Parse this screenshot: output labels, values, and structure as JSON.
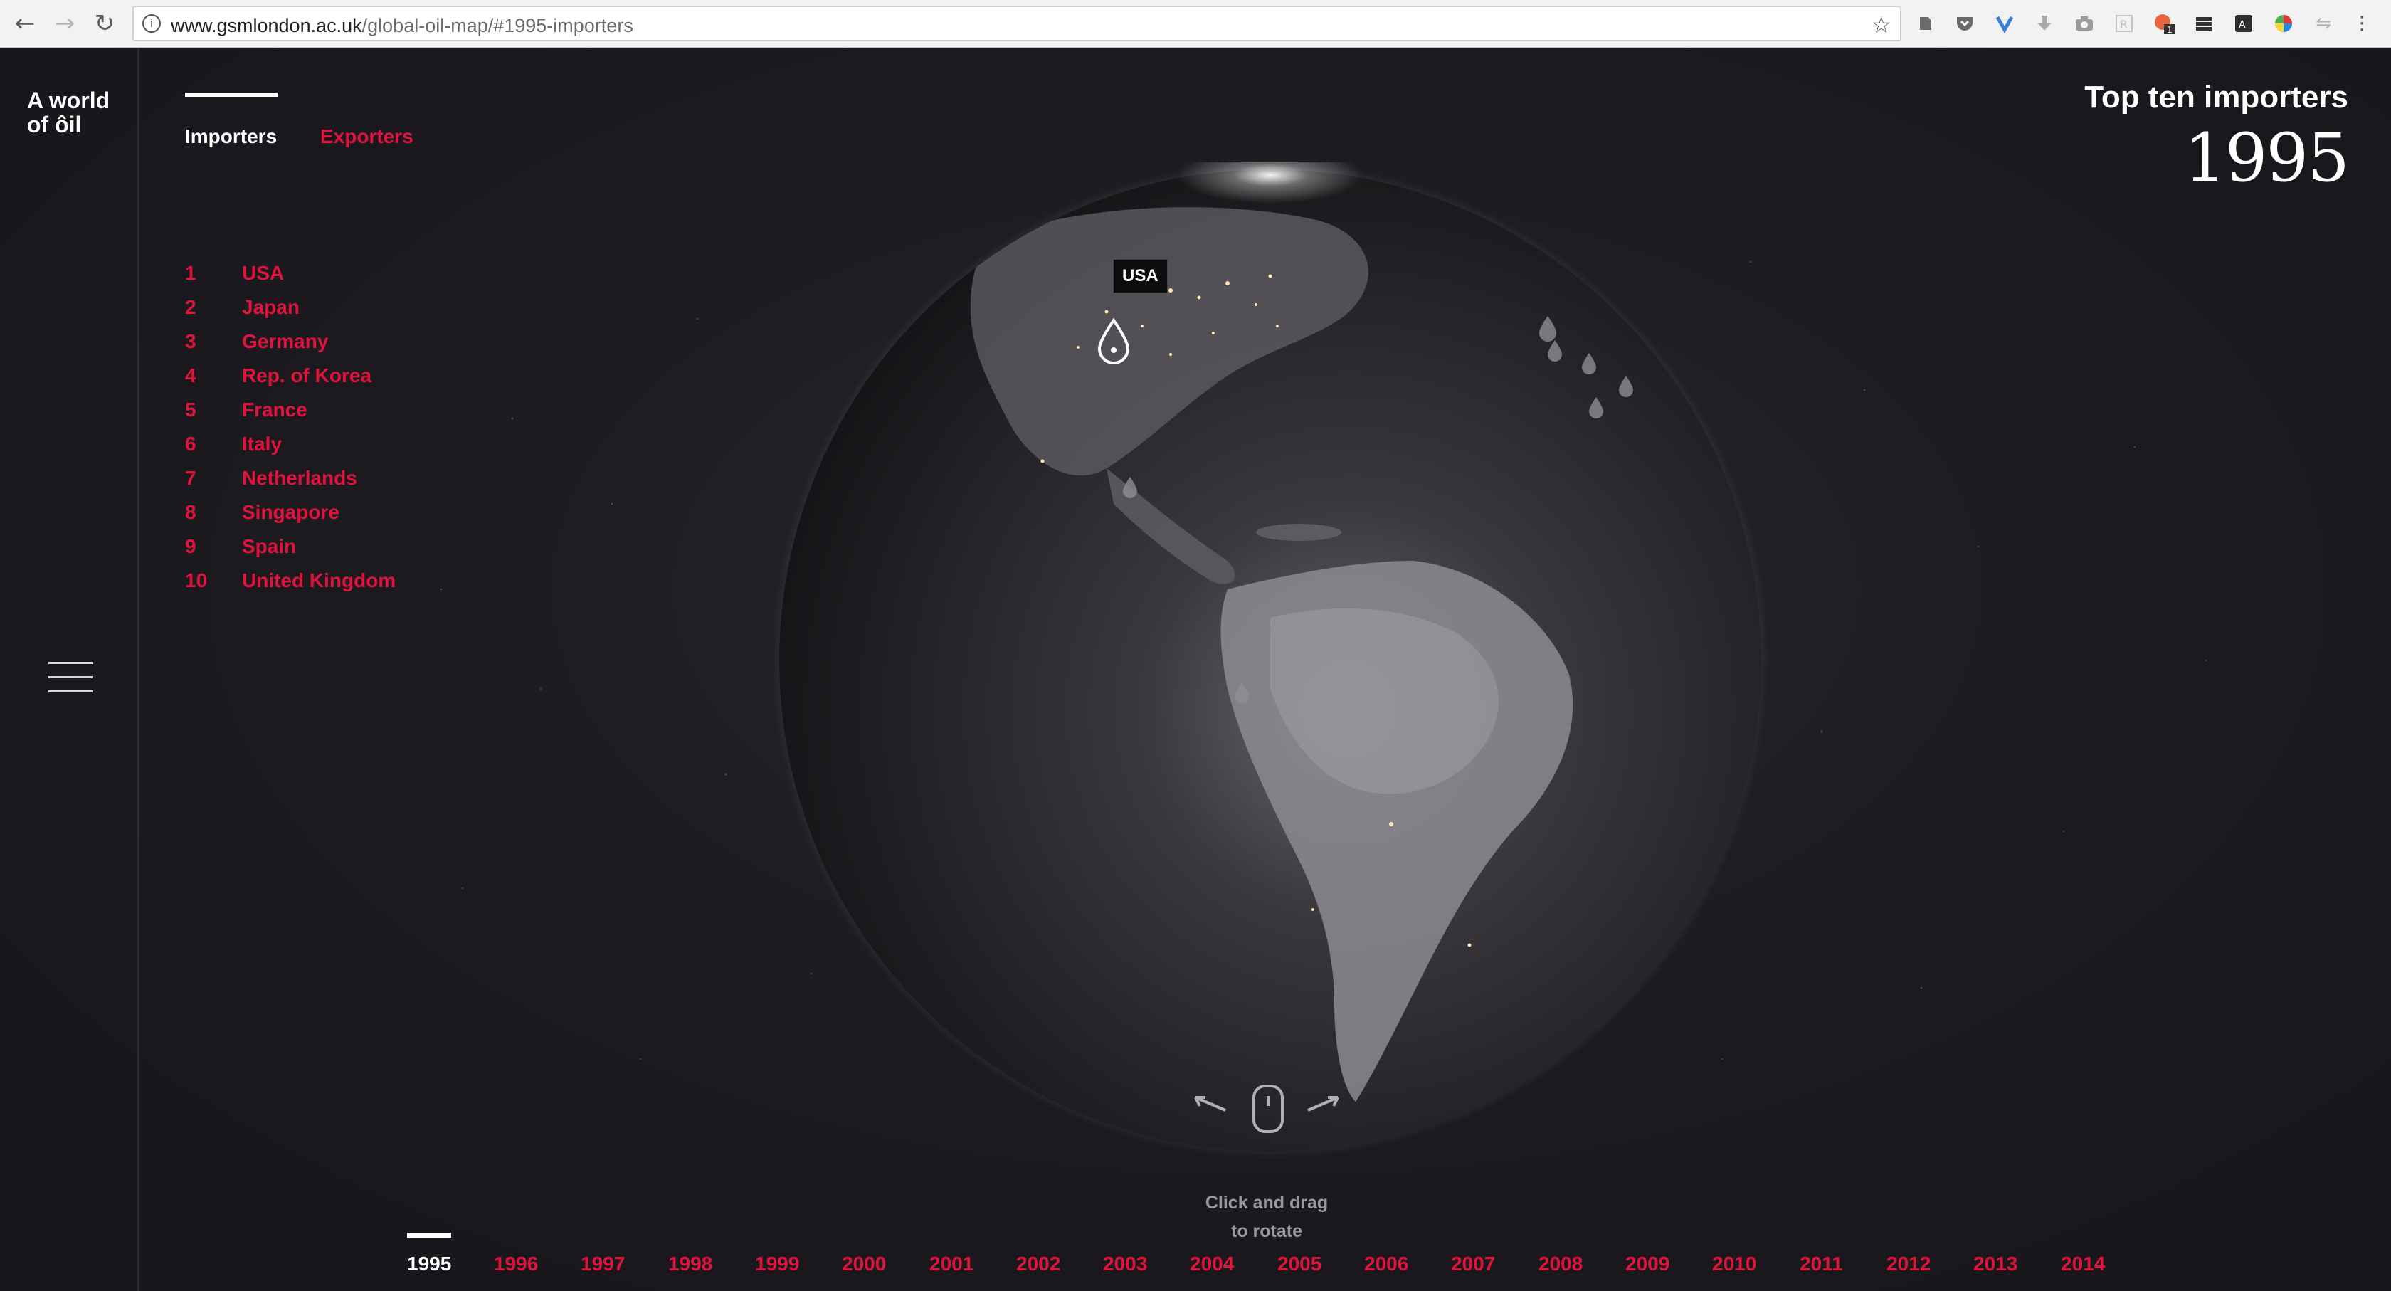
{
  "browser": {
    "url_domain": "www.gsmlondon.ac.uk",
    "url_path": "/global-oil-map/#1995-importers",
    "info_icon": "info-icon",
    "nav": {
      "back_icon": "←",
      "forward_icon": "→",
      "reload_icon": "↻"
    },
    "star_icon": "☆",
    "extensions": [
      "evernote-icon",
      "pocket-icon",
      "vivaldi-icon",
      "download-icon",
      "camera-icon",
      "readability-icon",
      "notification-icon",
      "stack-icon",
      "translate-icon",
      "color-wheel-icon",
      "sync-icon",
      "menu-icon"
    ]
  },
  "app": {
    "logo_line1": "A world",
    "logo_line2": "of ôil",
    "tabs": [
      {
        "label": "Importers",
        "active": true
      },
      {
        "label": "Exporters",
        "active": false
      }
    ],
    "ranking": [
      {
        "rank": "1",
        "country": "USA"
      },
      {
        "rank": "2",
        "country": "Japan"
      },
      {
        "rank": "3",
        "country": "Germany"
      },
      {
        "rank": "4",
        "country": "Rep. of Korea"
      },
      {
        "rank": "5",
        "country": "France"
      },
      {
        "rank": "6",
        "country": "Italy"
      },
      {
        "rank": "7",
        "country": "Netherlands"
      },
      {
        "rank": "8",
        "country": "Singapore"
      },
      {
        "rank": "9",
        "country": "Spain"
      },
      {
        "rank": "10",
        "country": "United Kingdom"
      }
    ],
    "heading_title": "Top ten importers",
    "heading_year": "1995",
    "marker_label": "USA",
    "hint_line1": "Click and drag",
    "hint_line2": "to rotate",
    "years": [
      "1995",
      "1996",
      "1997",
      "1998",
      "1999",
      "2000",
      "2001",
      "2002",
      "2003",
      "2004",
      "2005",
      "2006",
      "2007",
      "2008",
      "2009",
      "2010",
      "2011",
      "2012",
      "2013",
      "2014"
    ],
    "selected_year": "1995"
  },
  "colors": {
    "accent": "#e0133d",
    "active_text": "#ffffff",
    "background": "#1a181c",
    "hint_text": "#9a989c"
  }
}
